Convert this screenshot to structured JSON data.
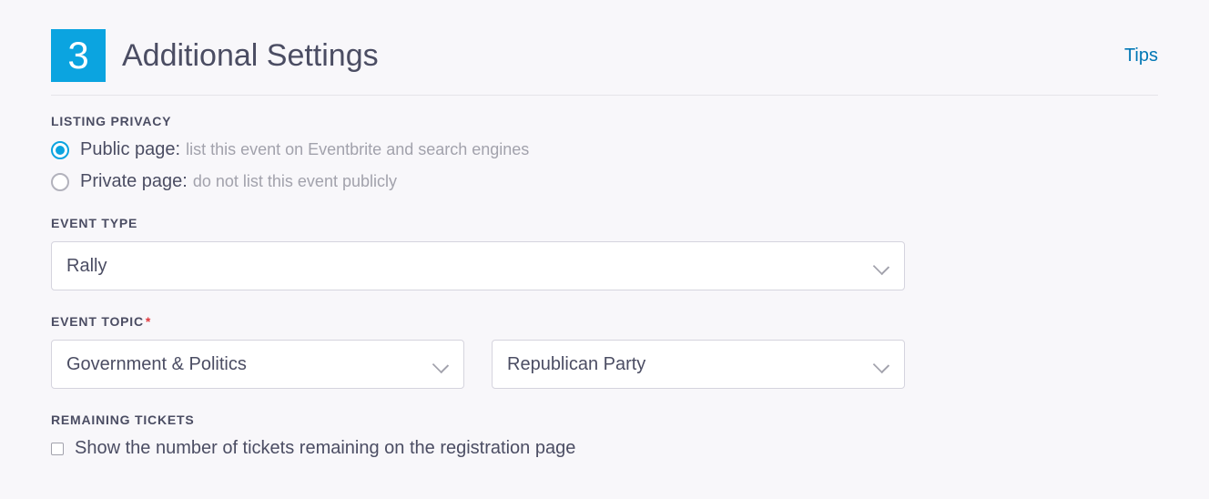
{
  "step": {
    "number": "3",
    "title": "Additional Settings",
    "tips_label": "Tips"
  },
  "listing_privacy": {
    "label": "LISTING PRIVACY",
    "options": [
      {
        "title": "Public page:",
        "desc": "list this event on Eventbrite and search engines",
        "selected": true
      },
      {
        "title": "Private page:",
        "desc": "do not list this event publicly",
        "selected": false
      }
    ]
  },
  "event_type": {
    "label": "EVENT TYPE",
    "value": "Rally",
    "required": false
  },
  "event_topic": {
    "label": "EVENT TOPIC",
    "required": true,
    "required_mark": "*",
    "primary": "Government & Politics",
    "secondary": "Republican Party"
  },
  "remaining_tickets": {
    "label": "REMAINING TICKETS",
    "checkbox_label": "Show the number of tickets remaining on the registration page",
    "checked": false
  }
}
